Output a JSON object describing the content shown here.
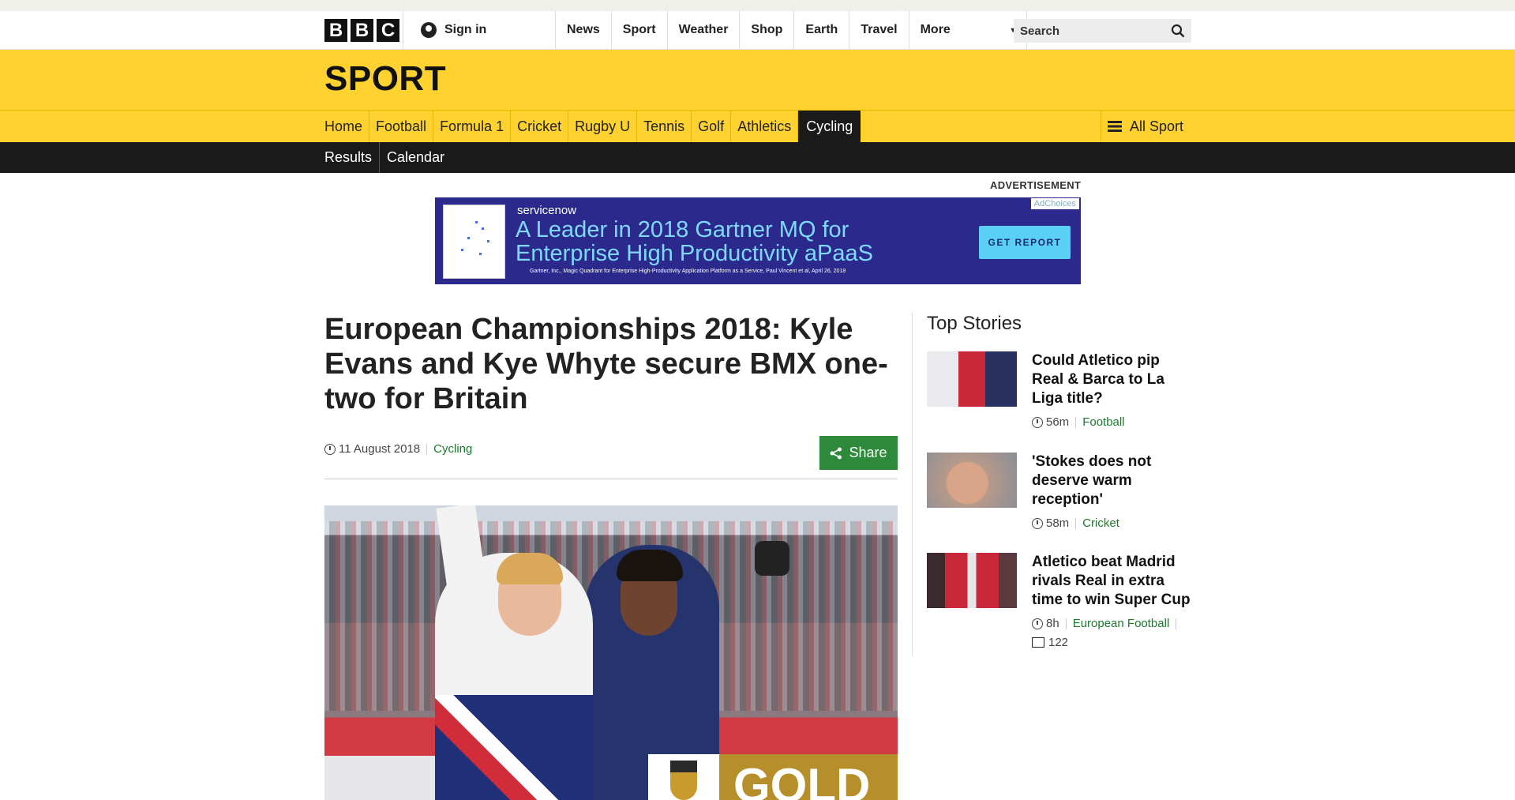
{
  "brand": {
    "letters": [
      "B",
      "B",
      "C"
    ]
  },
  "header": {
    "signin_label": "Sign in",
    "nav": [
      "News",
      "Sport",
      "Weather",
      "Shop",
      "Earth",
      "Travel"
    ],
    "more_label": "More",
    "search_placeholder": "Search"
  },
  "section": {
    "title": "SPORT"
  },
  "sportnav": {
    "links": [
      "Home",
      "Football",
      "Formula 1",
      "Cricket",
      "Rugby U",
      "Tennis",
      "Golf",
      "Athletics",
      "Cycling"
    ],
    "active": "Cycling",
    "all_sport_label": "All Sport"
  },
  "subnav": {
    "links": [
      "Results",
      "Calendar"
    ]
  },
  "ad": {
    "label": "ADVERTISEMENT",
    "brand": "servicenow",
    "headline": "A Leader in 2018 Gartner MQ for Enterprise High Productivity aPaaS",
    "fineprint": "Gartner, Inc., Magic Quadrant for Enterprise High-Productivity Application Platform as a Service, Paul Vincent et al, April 26, 2018",
    "cta": "GET REPORT",
    "adchoices": "AdChoices"
  },
  "article": {
    "headline": "European Championships 2018: Kyle Evans and Kye Whyte secure BMX one-two for Britain",
    "date": "11 August 2018",
    "category": "Cycling",
    "share_label": "Share",
    "image_overlay": "GOLD"
  },
  "top_stories": {
    "title": "Top Stories",
    "items": [
      {
        "title": "Could Atletico pip Real & Barca to La Liga title?",
        "time": "56m",
        "category": "Football"
      },
      {
        "title": "'Stokes does not deserve warm reception'",
        "time": "58m",
        "category": "Cricket"
      },
      {
        "title": "Atletico beat Madrid rivals Real in extra time to win Super Cup",
        "time": "8h",
        "category": "European Football",
        "comments": "122"
      }
    ]
  }
}
